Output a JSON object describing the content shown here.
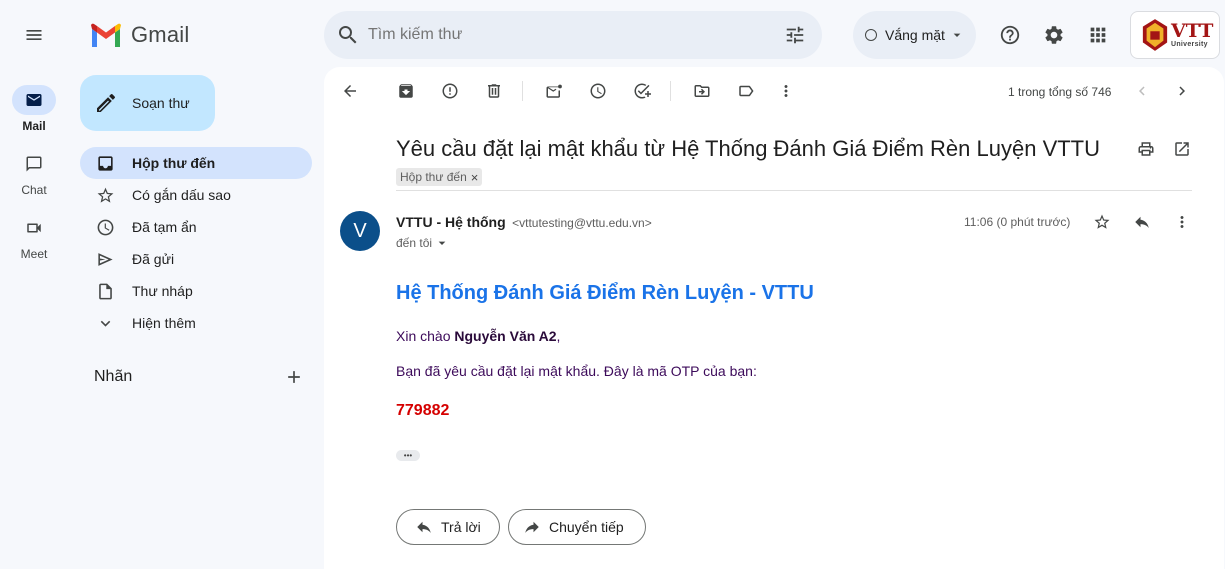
{
  "app": {
    "name": "Gmail"
  },
  "search": {
    "placeholder": "Tìm kiếm thư"
  },
  "status": {
    "label": "Vắng mặt"
  },
  "brand": {
    "logo_text": "VTT",
    "logo_subtext": "University"
  },
  "rail": [
    {
      "label": "Mail",
      "icon": "mail-icon"
    },
    {
      "label": "Chat",
      "icon": "chat-icon"
    },
    {
      "label": "Meet",
      "icon": "meet-icon"
    }
  ],
  "compose": {
    "label": "Soạn thư"
  },
  "nav": {
    "items": [
      {
        "label": "Hộp thư đến",
        "icon": "inbox-icon"
      },
      {
        "label": "Có gắn dấu sao",
        "icon": "star-icon"
      },
      {
        "label": "Đã tạm ẩn",
        "icon": "clock-icon"
      },
      {
        "label": "Đã gửi",
        "icon": "send-icon"
      },
      {
        "label": "Thư nháp",
        "icon": "draft-icon"
      },
      {
        "label": "Hiện thêm",
        "icon": "chevron-down-icon"
      }
    ],
    "labels_heading": "Nhãn"
  },
  "pagination": {
    "text": "1 trong tổng số 746"
  },
  "email": {
    "subject": "Yêu cầu đặt lại mật khẩu từ Hệ Thống Đánh Giá Điểm Rèn Luyện VTTU",
    "label_chip": "Hộp thư đến",
    "chip_close": "×",
    "sender_initial": "V",
    "sender_name": "VTTU - Hệ thống",
    "sender_email": "<vttutesting@vttu.edu.vn>",
    "to": "đến tôi",
    "time": "11:06 (0 phút trước)",
    "body": {
      "heading": "Hệ Thống Đánh Giá Điểm Rèn Luyện - VTTU",
      "greeting_prefix": "Xin chào ",
      "greeting_name": "Nguyễn Văn A2",
      "greeting_suffix": ",",
      "message": "Bạn đã yêu cầu đặt lại mật khẩu. Đây là mã OTP của bạn:",
      "otp": "779882",
      "ellipsis": "•••"
    },
    "reply_label": "Trả lời",
    "forward_label": "Chuyển tiếp"
  },
  "colors": {
    "accent": "#0b57d0",
    "heading_blue": "#1a73e8",
    "otp_red": "#d50000",
    "purple_text": "#3c0a5a",
    "avatar_bg": "#0b4f8a"
  }
}
